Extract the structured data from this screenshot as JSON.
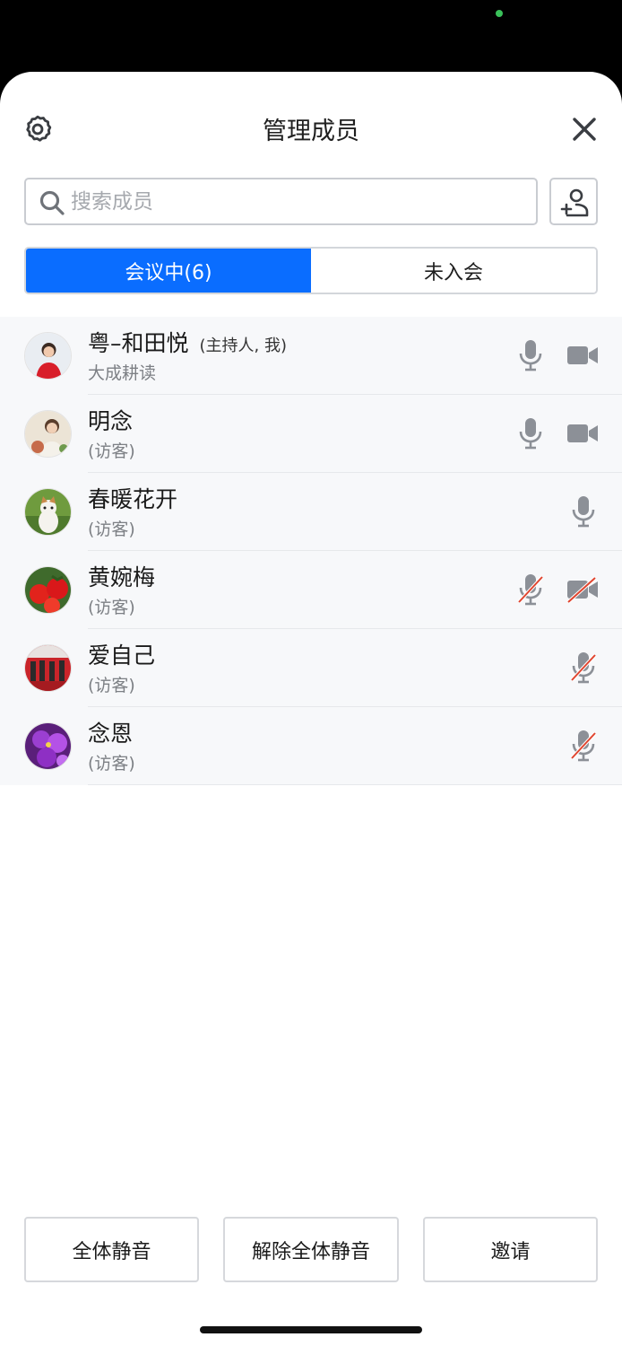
{
  "colors": {
    "accent": "#0a6dff",
    "icon_gray": "#8c9097",
    "muted_red": "#e0452f",
    "camera_dot": "#3ac15a"
  },
  "header": {
    "title": "管理成员",
    "settings_icon": "gear-icon",
    "close_icon": "close-icon"
  },
  "search": {
    "placeholder": "搜索成员",
    "value": "",
    "icon": "search-icon",
    "add_member_icon": "add-member-icon"
  },
  "tabs": [
    {
      "label": "会议中(6)",
      "active": true
    },
    {
      "label": "未入会",
      "active": false
    }
  ],
  "members": [
    {
      "name": "粤–和田悦",
      "role": "(主持人, 我)",
      "subtitle": "大成耕读",
      "mic": "on",
      "camera": "on"
    },
    {
      "name": "明念",
      "role": "",
      "subtitle": "(访客)",
      "mic": "on",
      "camera": "on"
    },
    {
      "name": "春暖花开",
      "role": "",
      "subtitle": "(访客)",
      "mic": "on",
      "camera": "none"
    },
    {
      "name": "黄婉梅",
      "role": "",
      "subtitle": "(访客)",
      "mic": "muted",
      "camera": "off"
    },
    {
      "name": "爱自己",
      "role": "",
      "subtitle": "(访客)",
      "mic": "muted",
      "camera": "none"
    },
    {
      "name": "念恩",
      "role": "",
      "subtitle": "(访客)",
      "mic": "muted",
      "camera": "none"
    }
  ],
  "footer": {
    "mute_all": "全体静音",
    "unmute_all": "解除全体静音",
    "invite": "邀请"
  }
}
